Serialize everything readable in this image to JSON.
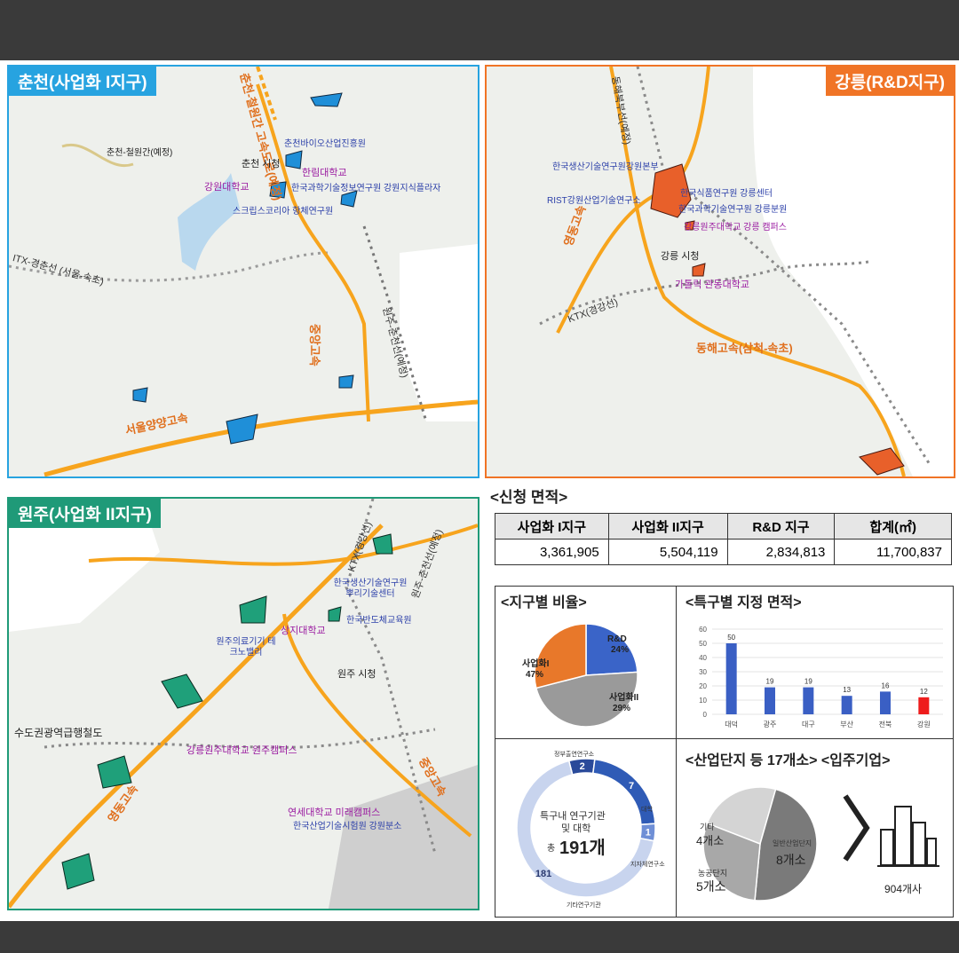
{
  "maps": {
    "chuncheon": {
      "title": "춘천(사업화 I지구)",
      "labels": {
        "expressway_construction": "춘천-철원간 고속도로(예정)",
        "chuncheon_cheorwon": "춘천-철원간(예정)",
        "bio_foundation": "춘천바이오산업진흥원",
        "city_hall": "춘천 시청",
        "hallym_univ": "한림대학교",
        "kangwon_univ": "강원대학교",
        "kist": "한국과학기술정보연구원 강원지식플라자",
        "scripps": "스크립스코리아 항체연구원",
        "itx": "ITX-경춘선 (서울-속초)",
        "jungang": "중앙고속",
        "wonju_chuncheon_line": "원주-춘천선(예정)",
        "seoul_yangyang": "서울양양고속"
      }
    },
    "gangneung": {
      "title": "강릉(R&D지구)",
      "labels": {
        "donghae_line": "동해북부선(예정)",
        "kitech": "한국생산기술연구원강원본부",
        "rist": "RIST강원산업기술연구소",
        "food_inst": "한국식품연구원 강릉센터",
        "kist_gangneung": "한국과학기술연구원 강릉분원",
        "gwu": "강릉원주대학교 강릉 캠퍼스",
        "yeongdong": "영동고속",
        "city_hall": "강릉 시청",
        "catholic": "가톨릭 관동대학교",
        "ktx": "KTX(경강선)",
        "donghae_expressway": "동해고속(삼척-속초)"
      }
    },
    "wonju": {
      "title": "원주(사업화 II지구)",
      "labels": {
        "ktx": "KTX(경강선)",
        "wonju_chuncheon_line": "원주-춘천선(예정)",
        "kitech": "한국생산기술연구원 뿌리기술센터",
        "sangji": "상지대학교",
        "semiconductor": "한국반도체교육원",
        "medical_valley": "원주의료기기 테크노밸리",
        "city_hall": "원주 시청",
        "metro_rail": "수도권광역급행철도",
        "gwu_wonju": "강릉원주대학교 원주캠퍼스",
        "yonsei": "연세대학교 미래캠퍼스",
        "ktl": "한국산업기술시험원 강원분소",
        "jungang": "중앙고속",
        "yeongdong": "영동고속"
      }
    }
  },
  "area": {
    "title": "<신청 면적>",
    "headers": [
      "사업화 I지구",
      "사업화 II지구",
      "R&D 지구",
      "합계(㎡)"
    ],
    "values": [
      "3,361,905",
      "5,504,119",
      "2,834,813",
      "11,700,837"
    ]
  },
  "district_ratio": {
    "title": "<지구별 비율>",
    "labels": {
      "rd": "R&D 24%",
      "biz1": "사업화I 47%",
      "biz2": "사업화II 29%"
    }
  },
  "special_zone": {
    "title": "<특구별 지정 면적>"
  },
  "research": {
    "labels": {
      "gov": "정부출연연구소",
      "gov_val": "2",
      "univ": "대학",
      "univ_val": "7",
      "other_inst": "지자체연구소",
      "other_inst_val": "1",
      "etc": "기타연구기관",
      "etc_val": "181",
      "center_top": "특구내 연구기관",
      "center_mid": "및 대학",
      "center_prefix": "총",
      "center_num": "191개"
    }
  },
  "industrial": {
    "title": "<산업단지 등 17개소> <입주기업>",
    "labels": {
      "etc_name": "기타",
      "etc_val": "4개소",
      "general_name": "일반산업단지",
      "general_val": "8개소",
      "agri_name": "농공단지",
      "agri_val": "5개소",
      "companies": "904개사"
    }
  },
  "chart_data": [
    {
      "type": "pie",
      "title": "<지구별 비율>",
      "categories": [
        "R&D",
        "사업화I",
        "사업화II"
      ],
      "values": [
        24,
        47,
        29
      ],
      "colors": [
        "#3a64c8",
        "#9a9a9a",
        "#e8782a"
      ]
    },
    {
      "type": "bar",
      "title": "<특구별 지정 면적>",
      "categories": [
        "대덕",
        "광주",
        "대구",
        "부산",
        "전북",
        "강원"
      ],
      "values": [
        50,
        19,
        19,
        13,
        16,
        12
      ],
      "ylim": [
        0,
        60
      ],
      "yticks": [
        "0",
        "10",
        "20",
        "30",
        "40",
        "50",
        "60"
      ],
      "colors": [
        "#3a5fc4",
        "#3a5fc4",
        "#3a5fc4",
        "#3a5fc4",
        "#3a5fc4",
        "#ee1c1c"
      ]
    },
    {
      "type": "pie",
      "title": "특구내 연구기관 및 대학",
      "categories": [
        "정부출연연구소",
        "대학",
        "지자체연구소",
        "기타연구기관"
      ],
      "values": [
        2,
        7,
        1,
        181
      ],
      "colors": [
        "#2a4a9a",
        "#2f5bb6",
        "#6f8fd6",
        "#c8d4ee"
      ]
    },
    {
      "type": "pie",
      "title": "<산업단지 등 17개소>",
      "categories": [
        "기타",
        "일반산업단지",
        "농공단지"
      ],
      "values": [
        4,
        8,
        5
      ],
      "colors": [
        "#d4d4d4",
        "#7a7a7a",
        "#a8a8a8"
      ]
    }
  ]
}
